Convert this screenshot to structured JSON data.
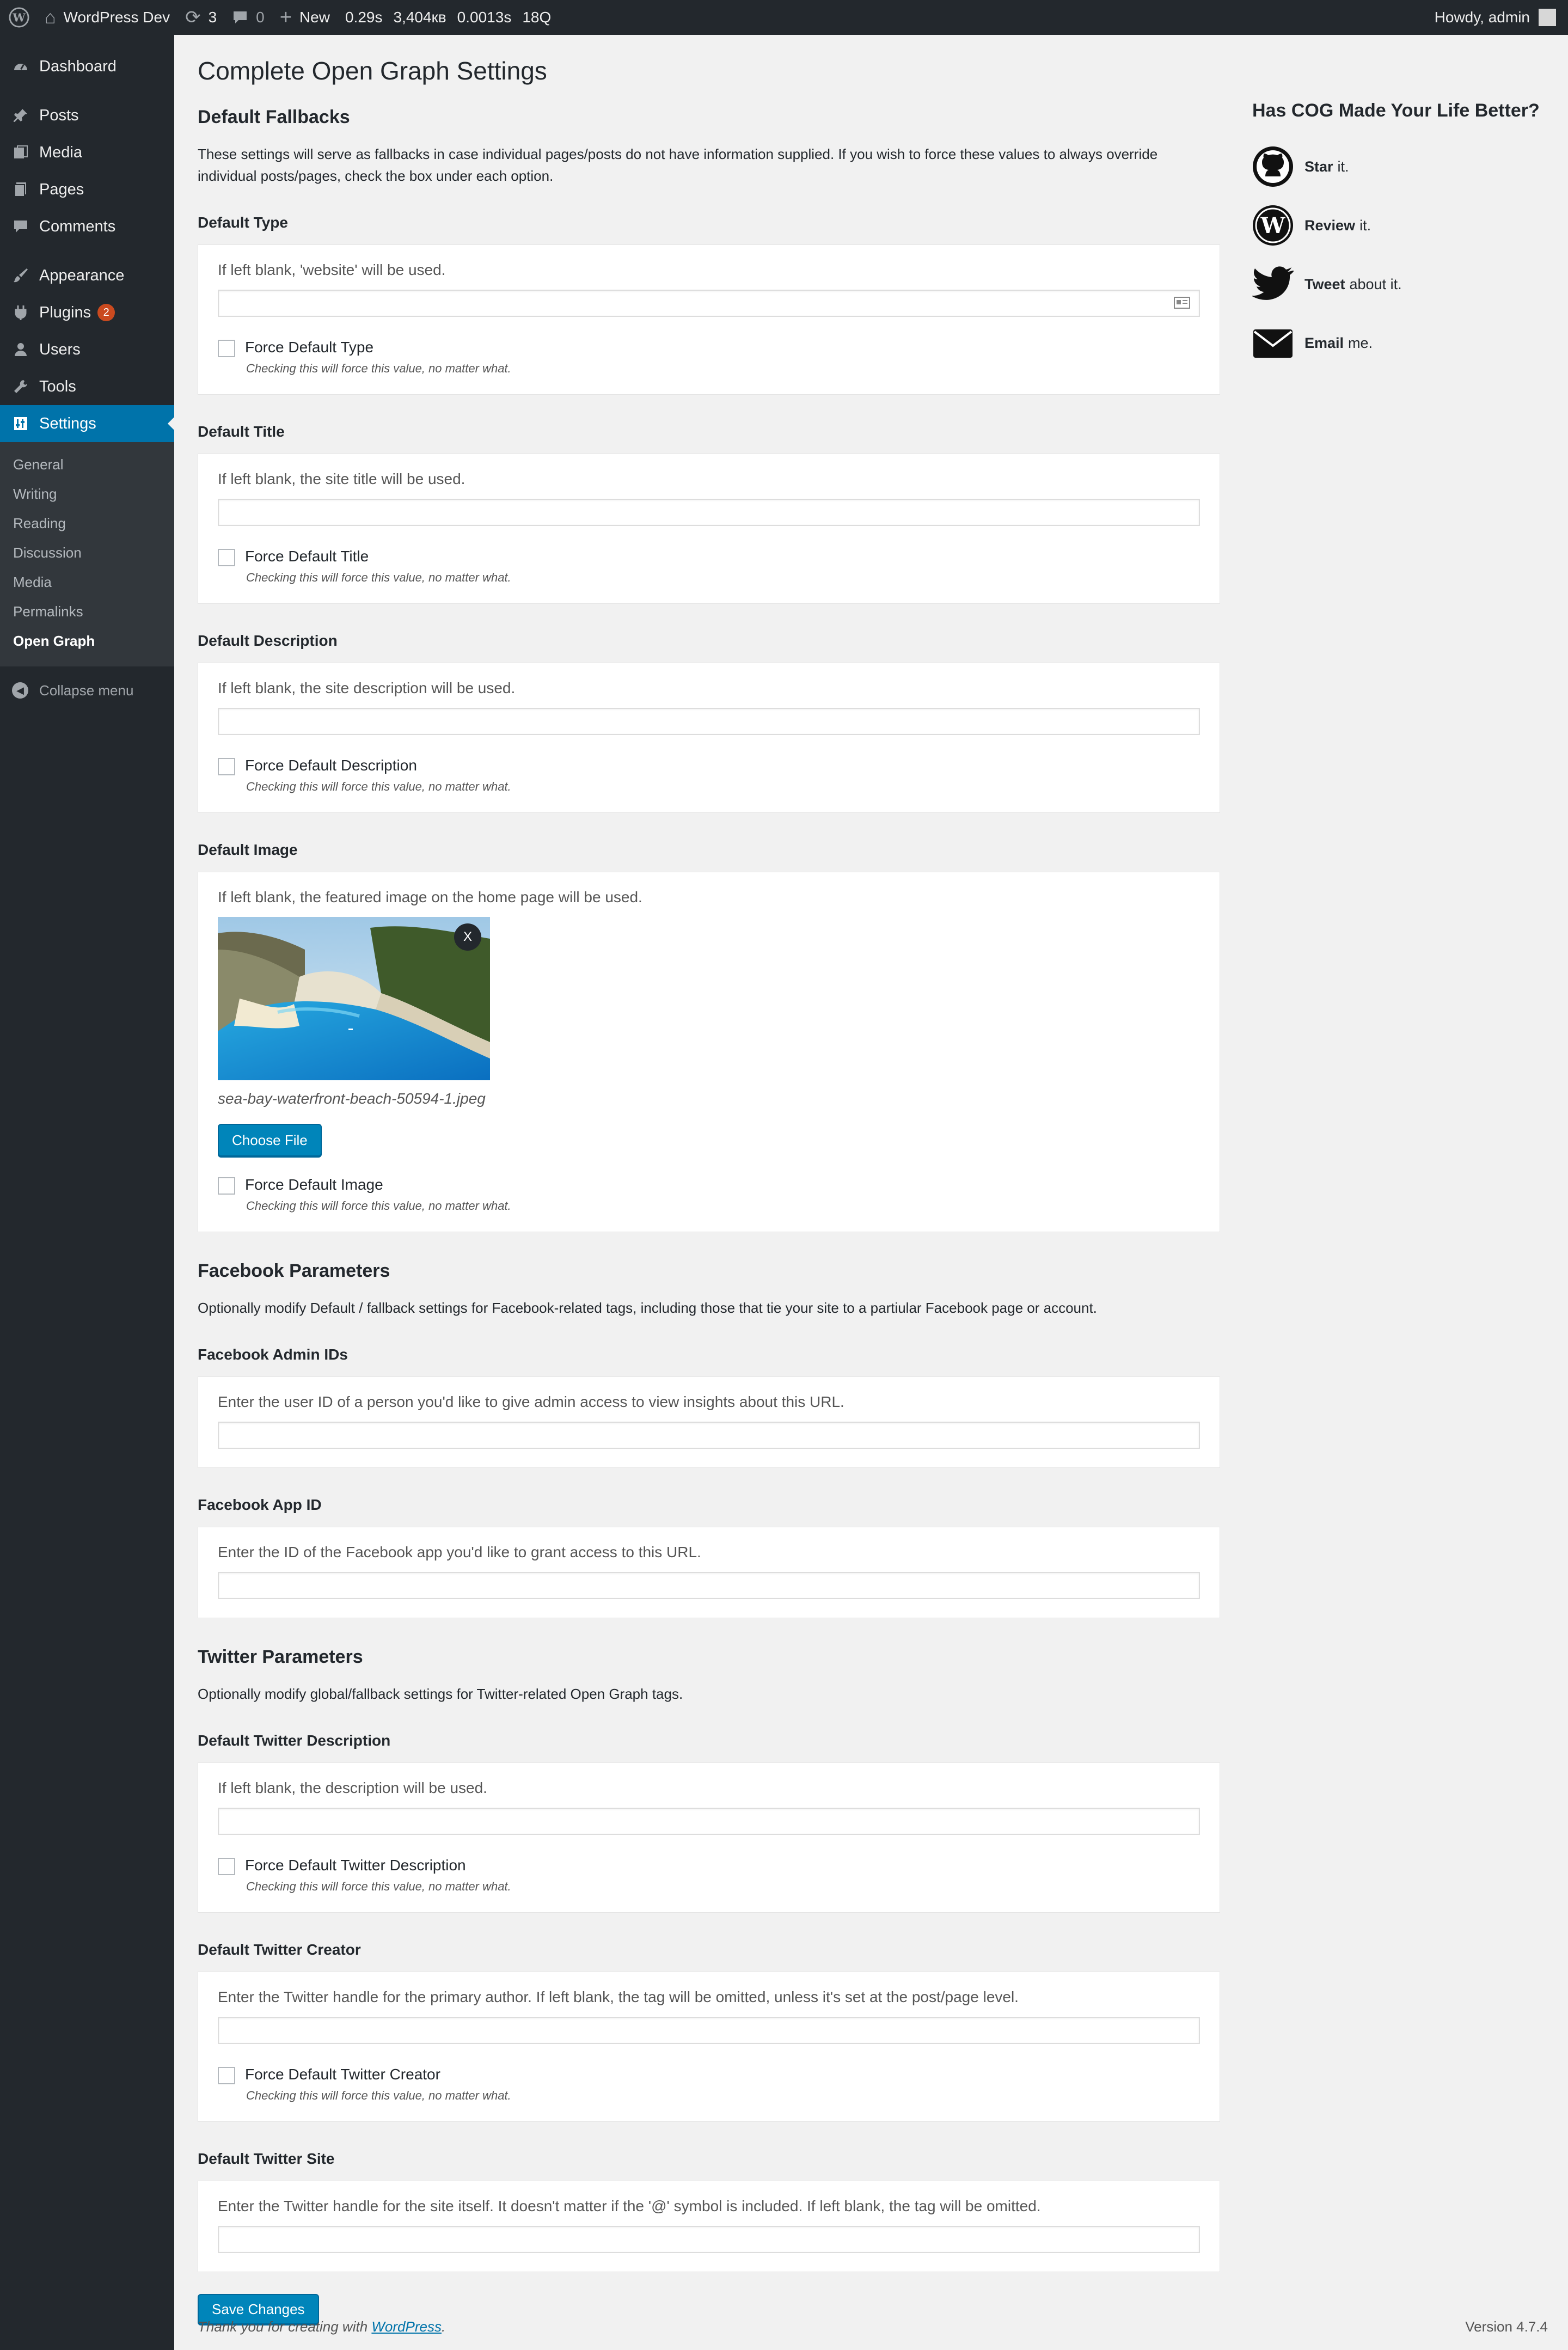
{
  "adminbar": {
    "site_name": "WordPress Dev",
    "updates_count": "3",
    "comments_count": "0",
    "new_label": "New",
    "stats": [
      "0.29s",
      "3,404кв",
      "0.0013s",
      "18Q"
    ],
    "greeting": "Howdy, admin"
  },
  "sidebar": {
    "items": [
      {
        "label": "Dashboard",
        "icon": "dashboard-icon"
      },
      {
        "label": "Posts",
        "icon": "pin-icon"
      },
      {
        "label": "Media",
        "icon": "media-icon"
      },
      {
        "label": "Pages",
        "icon": "pages-icon"
      },
      {
        "label": "Comments",
        "icon": "comment-icon"
      },
      {
        "label": "Appearance",
        "icon": "brush-icon"
      },
      {
        "label": "Plugins",
        "icon": "plugin-icon",
        "badge": "2"
      },
      {
        "label": "Users",
        "icon": "user-icon"
      },
      {
        "label": "Tools",
        "icon": "wrench-icon"
      },
      {
        "label": "Settings",
        "icon": "settings-icon"
      }
    ],
    "submenu": [
      "General",
      "Writing",
      "Reading",
      "Discussion",
      "Media",
      "Permalinks",
      "Open Graph"
    ],
    "collapse_label": "Collapse menu"
  },
  "page": {
    "title": "Complete Open Graph Settings",
    "fallbacks": {
      "title": "Default Fallbacks",
      "description": "These settings will serve as fallbacks in case individual pages/posts do not have information supplied. If you wish to force these values to always override individual posts/pages, check the box under each option.",
      "note": "Checking this will force this value, no matter what.",
      "type": {
        "label": "Default Type",
        "hint": "If left blank, 'website' will be used.",
        "value": "",
        "checkbox": "Force Default Type"
      },
      "title_field": {
        "label": "Default Title",
        "hint": "If left blank, the site title will be used.",
        "value": "",
        "checkbox": "Force Default Title"
      },
      "description_field": {
        "label": "Default Description",
        "hint": "If left blank, the site description will be used.",
        "value": "",
        "checkbox": "Force Default Description"
      },
      "image": {
        "label": "Default Image",
        "hint": "If left blank, the featured image on the home page will be used.",
        "filename": "sea-bay-waterfront-beach-50594-1.jpeg",
        "remove_label": "X",
        "button": "Choose File",
        "checkbox": "Force Default Image"
      }
    },
    "facebook": {
      "title": "Facebook Parameters",
      "description": "Optionally modify Default / fallback settings for Facebook-related tags, including those that tie your site to a partiular Facebook page or account.",
      "admin_ids": {
        "label": "Facebook Admin IDs",
        "hint": "Enter the user ID of a person you'd like to give admin access to view insights about this URL.",
        "value": ""
      },
      "app_id": {
        "label": "Facebook App ID",
        "hint": "Enter the ID of the Facebook app you'd like to grant access to this URL.",
        "value": ""
      }
    },
    "twitter": {
      "title": "Twitter Parameters",
      "description": "Optionally modify global/fallback settings for Twitter-related Open Graph tags.",
      "description_field": {
        "label": "Default Twitter Description",
        "hint": "If left blank, the description will be used.",
        "value": "",
        "checkbox": "Force Default Twitter Description"
      },
      "creator": {
        "label": "Default Twitter Creator",
        "hint": "Enter the Twitter handle for the primary author. If left blank, the tag will be omitted, unless it's set at the post/page level.",
        "value": "",
        "checkbox": "Force Default Twitter Creator"
      },
      "site": {
        "label": "Default Twitter Site",
        "hint": "Enter the Twitter handle for the site itself. It doesn't matter if the '@' symbol is included. If left blank, the tag will be omitted.",
        "value": ""
      }
    },
    "save_button": "Save Changes"
  },
  "aside": {
    "title": "Has COG Made Your Life Better?",
    "items": [
      {
        "strong": "Star",
        "rest": "it.",
        "icon": "github-icon"
      },
      {
        "strong": "Review",
        "rest": "it.",
        "icon": "wordpress-icon"
      },
      {
        "strong": "Tweet",
        "rest": "about it.",
        "icon": "twitter-icon"
      },
      {
        "strong": "Email",
        "rest": "me.",
        "icon": "email-icon"
      }
    ]
  },
  "footer": {
    "thanks_prefix": "Thank you for creating with",
    "thanks_link": "WordPress",
    "thanks_suffix": ".",
    "version": "Version 4.7.4"
  },
  "colors": {
    "accent": "#0073aa",
    "button": "#0085ba",
    "sidebar": "#23282d",
    "badge": "#ca4a1f"
  }
}
